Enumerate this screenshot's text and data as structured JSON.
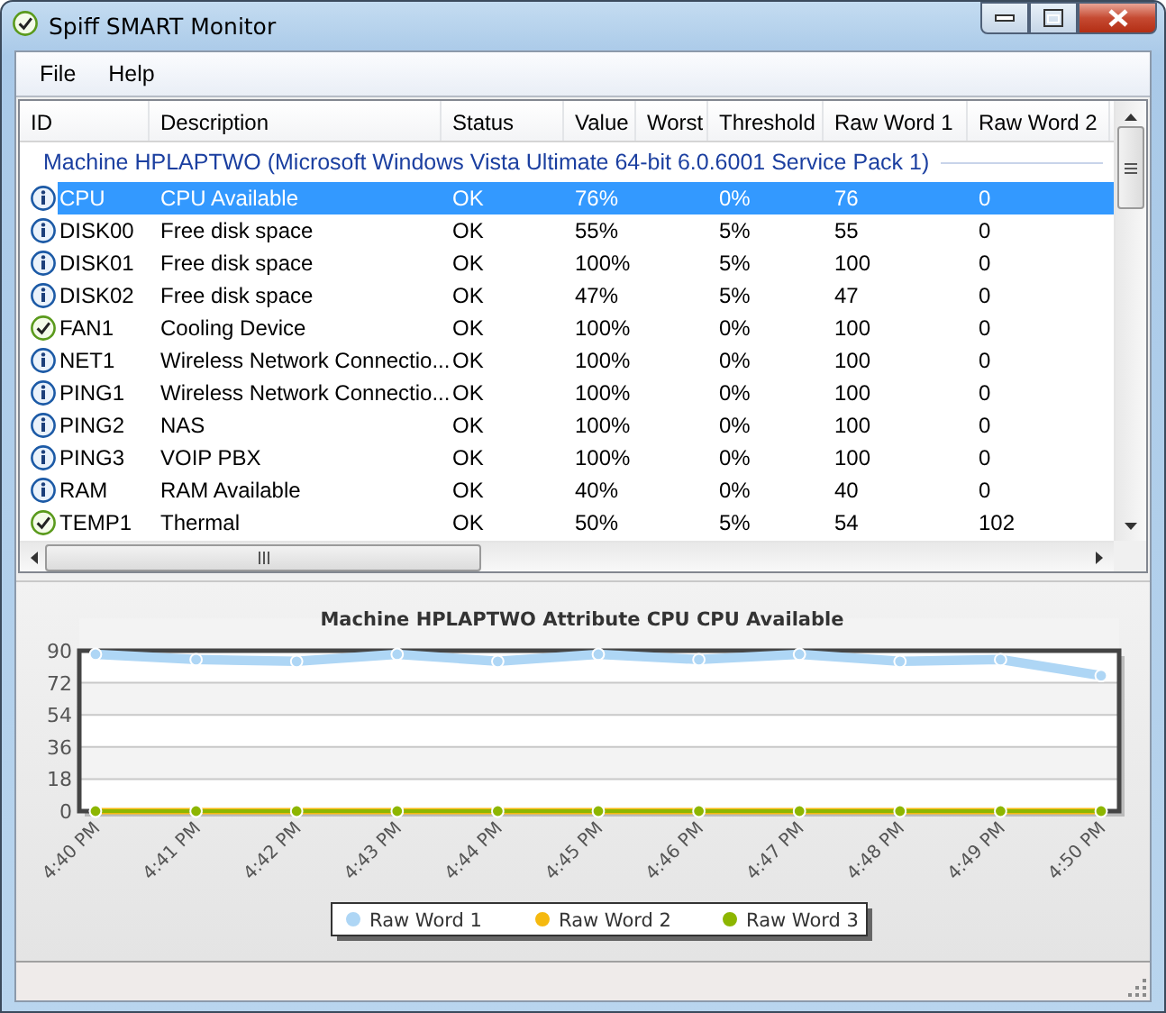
{
  "window": {
    "title": "Spiff SMART Monitor"
  },
  "menu": [
    "File",
    "Help"
  ],
  "list": {
    "columns": [
      "ID",
      "Description",
      "Status",
      "Value",
      "Worst",
      "Threshold",
      "Raw Word 1",
      "Raw Word 2"
    ],
    "group": "Machine HPLAPTWO (Microsoft Windows Vista Ultimate 64-bit 6.0.6001 Service Pack 1)",
    "rows": [
      {
        "kind": "info",
        "selected": true,
        "cells": [
          "CPU",
          "CPU Available",
          "OK",
          "76%",
          "",
          "0%",
          "76",
          "0"
        ]
      },
      {
        "kind": "info",
        "selected": false,
        "cells": [
          "DISK00",
          "Free disk space",
          "OK",
          "55%",
          "",
          "5%",
          "55",
          "0"
        ]
      },
      {
        "kind": "info",
        "selected": false,
        "cells": [
          "DISK01",
          "Free disk space",
          "OK",
          "100%",
          "",
          "5%",
          "100",
          "0"
        ]
      },
      {
        "kind": "info",
        "selected": false,
        "cells": [
          "DISK02",
          "Free disk space",
          "OK",
          "47%",
          "",
          "5%",
          "47",
          "0"
        ]
      },
      {
        "kind": "ok",
        "selected": false,
        "cells": [
          "FAN1",
          "Cooling Device",
          "OK",
          "100%",
          "",
          "0%",
          "100",
          "0"
        ]
      },
      {
        "kind": "info",
        "selected": false,
        "cells": [
          "NET1",
          "Wireless Network Connectio...",
          "OK",
          "100%",
          "",
          "0%",
          "100",
          "0"
        ]
      },
      {
        "kind": "info",
        "selected": false,
        "cells": [
          "PING1",
          "Wireless Network Connectio...",
          "OK",
          "100%",
          "",
          "0%",
          "100",
          "0"
        ]
      },
      {
        "kind": "info",
        "selected": false,
        "cells": [
          "PING2",
          "NAS",
          "OK",
          "100%",
          "",
          "0%",
          "100",
          "0"
        ]
      },
      {
        "kind": "info",
        "selected": false,
        "cells": [
          "PING3",
          "VOIP PBX",
          "OK",
          "100%",
          "",
          "0%",
          "100",
          "0"
        ]
      },
      {
        "kind": "info",
        "selected": false,
        "cells": [
          "RAM",
          "RAM Available",
          "OK",
          "40%",
          "",
          "0%",
          "40",
          "0"
        ]
      },
      {
        "kind": "ok",
        "selected": false,
        "cells": [
          "TEMP1",
          "Thermal",
          "OK",
          "50%",
          "",
          "5%",
          "54",
          "102"
        ]
      }
    ]
  },
  "graph": {
    "chart_data": {
      "type": "line",
      "title": "Machine HPLAPTWO Attribute CPU CPU Available",
      "categories": [
        "4:40 PM",
        "4:41 PM",
        "4:42 PM",
        "4:43 PM",
        "4:44 PM",
        "4:45 PM",
        "4:46 PM",
        "4:47 PM",
        "4:48 PM",
        "4:49 PM",
        "4:50 PM"
      ],
      "ylim": [
        0,
        90
      ],
      "yticks": [
        0,
        18,
        36,
        54,
        72,
        90
      ],
      "grid": true,
      "legend": true,
      "series": [
        {
          "name": "Raw Word 1",
          "color": "#aed6f5",
          "marker": "circle",
          "values": [
            88,
            85,
            84,
            88,
            84,
            88,
            85,
            88,
            84,
            85,
            76
          ]
        },
        {
          "name": "Raw Word 2",
          "color": "#f5b90f",
          "marker": "circle",
          "values": [
            0,
            0,
            0,
            0,
            0,
            0,
            0,
            0,
            0,
            0,
            0
          ]
        },
        {
          "name": "Raw Word 3",
          "color": "#8db600",
          "marker": "circle",
          "values": [
            0,
            0,
            0,
            0,
            0,
            0,
            0,
            0,
            0,
            0,
            0
          ]
        }
      ]
    }
  }
}
